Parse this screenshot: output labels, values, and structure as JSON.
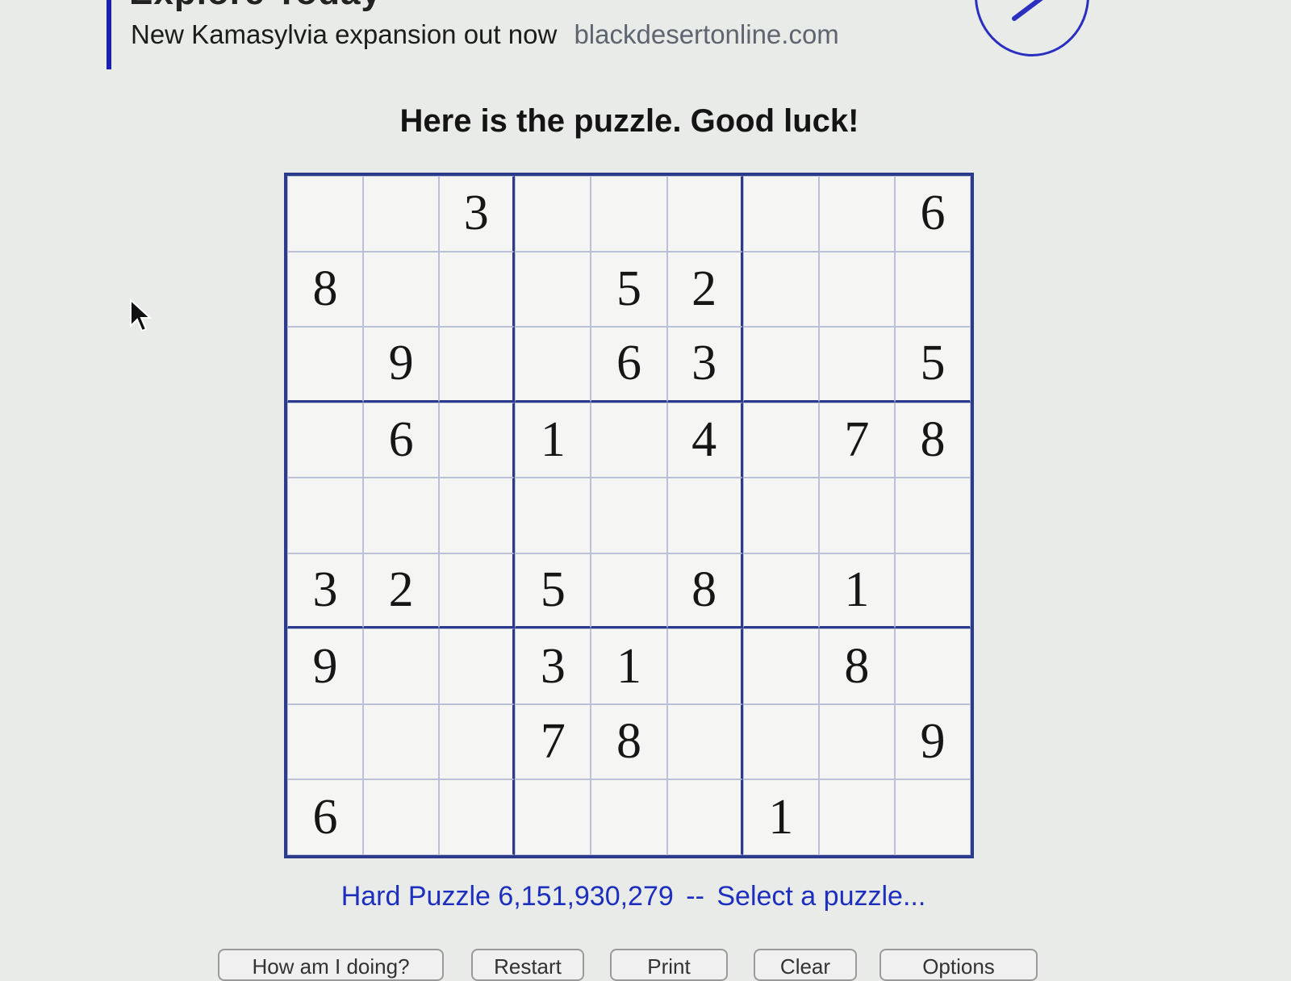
{
  "ad": {
    "title": "Explore Today",
    "text": "New Kamasylvia expansion out now",
    "domain": "blackdesertonline.com"
  },
  "headline": "Here is the puzzle. Good luck!",
  "puzzle": {
    "grid": [
      [
        "",
        "",
        "3",
        "",
        "",
        "",
        "",
        "",
        "6"
      ],
      [
        "8",
        "",
        "",
        "",
        "5",
        "2",
        "",
        "",
        ""
      ],
      [
        "",
        "9",
        "",
        "",
        "6",
        "3",
        "",
        "",
        "5"
      ],
      [
        "",
        "6",
        "",
        "1",
        "",
        "4",
        "",
        "7",
        "8"
      ],
      [
        "",
        "",
        "",
        "",
        "",
        "",
        "",
        "",
        ""
      ],
      [
        "3",
        "2",
        "",
        "5",
        "",
        "8",
        "",
        "1",
        ""
      ],
      [
        "9",
        "",
        "",
        "3",
        "1",
        "",
        "",
        "8",
        ""
      ],
      [
        "",
        "",
        "",
        "7",
        "8",
        "",
        "",
        "",
        "9"
      ],
      [
        "6",
        "",
        "",
        "",
        "",
        "",
        "1",
        "",
        ""
      ]
    ]
  },
  "footer": {
    "puzzle_label": "Hard Puzzle 6,151,930,279",
    "separator": "--",
    "select_link": "Select a puzzle..."
  },
  "bottom_buttons": [
    "How am I doing?",
    "Restart",
    "Print",
    "Clear",
    "Options"
  ],
  "colors": {
    "accent": "#1d2fbf",
    "grid_border": "#2b3a8a",
    "ad_bar": "#1b1fb0"
  },
  "icons": {
    "cursor": "arrow-cursor-icon",
    "ad_badge": "external-arrow-icon"
  }
}
